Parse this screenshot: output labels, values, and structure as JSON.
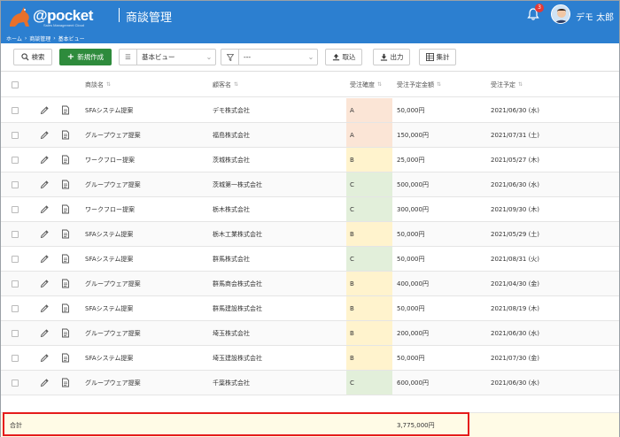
{
  "header": {
    "logo_text": "@pocket",
    "logo_sub": "Sales Management Cloud",
    "app_title": "商談管理",
    "notification_count": "3",
    "user_name": "デモ 太郎"
  },
  "breadcrumb": [
    "ホーム",
    "商談管理",
    "基本ビュー"
  ],
  "toolbar": {
    "search_label": "検索",
    "new_label": "新規作成",
    "view_select": "基本ビュー",
    "filter_select": "---",
    "import_label": "取込",
    "export_label": "出力",
    "aggregate_label": "集計"
  },
  "columns": {
    "deal": "商談名",
    "customer": "顧客名",
    "rank": "受注確度",
    "amount": "受注予定金額",
    "date": "受注予定"
  },
  "rows": [
    {
      "deal": "SFAシステム提案",
      "customer": "デモ株式会社",
      "rank": "A",
      "amount": "50,000円",
      "date": "2021/06/30 (水)"
    },
    {
      "deal": "グループウェア提案",
      "customer": "福島株式会社",
      "rank": "A",
      "amount": "150,000円",
      "date": "2021/07/31 (土)"
    },
    {
      "deal": "ワークフロー提案",
      "customer": "茨城株式会社",
      "rank": "B",
      "amount": "25,000円",
      "date": "2021/05/27 (木)"
    },
    {
      "deal": "グループウェア提案",
      "customer": "茨城第一株式会社",
      "rank": "C",
      "amount": "500,000円",
      "date": "2021/06/30 (水)"
    },
    {
      "deal": "ワークフロー提案",
      "customer": "栃木株式会社",
      "rank": "C",
      "amount": "300,000円",
      "date": "2021/09/30 (木)"
    },
    {
      "deal": "SFAシステム提案",
      "customer": "栃木工業株式会社",
      "rank": "B",
      "amount": "50,000円",
      "date": "2021/05/29 (土)"
    },
    {
      "deal": "SFAシステム提案",
      "customer": "群馬株式会社",
      "rank": "C",
      "amount": "50,000円",
      "date": "2021/08/31 (火)"
    },
    {
      "deal": "グループウェア提案",
      "customer": "群馬商会株式会社",
      "rank": "B",
      "amount": "400,000円",
      "date": "2021/04/30 (金)"
    },
    {
      "deal": "SFAシステム提案",
      "customer": "群馬建設株式会社",
      "rank": "B",
      "amount": "50,000円",
      "date": "2021/08/19 (木)"
    },
    {
      "deal": "グループウェア提案",
      "customer": "埼玉株式会社",
      "rank": "B",
      "amount": "200,000円",
      "date": "2021/06/30 (水)"
    },
    {
      "deal": "SFAシステム提案",
      "customer": "埼玉建設株式会社",
      "rank": "B",
      "amount": "50,000円",
      "date": "2021/07/30 (金)"
    },
    {
      "deal": "グループウェア提案",
      "customer": "千葉株式会社",
      "rank": "C",
      "amount": "600,000円",
      "date": "2021/06/30 (水)"
    }
  ],
  "total": {
    "label": "合計",
    "amount": "3,775,000円"
  }
}
